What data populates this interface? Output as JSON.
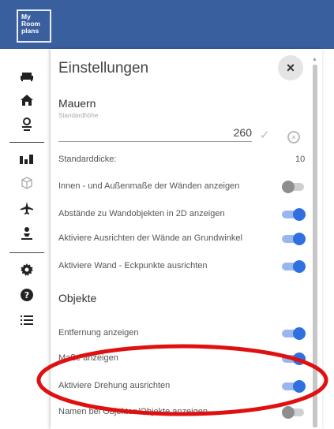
{
  "logo": {
    "lines": [
      "My",
      "Room",
      "plans"
    ]
  },
  "sidebar": {
    "items": [
      {
        "icon": "sofa-icon"
      },
      {
        "icon": "home-icon"
      },
      {
        "icon": "person-pin-icon"
      },
      {
        "icon": "walls-icon"
      },
      {
        "icon": "cube-icon"
      },
      {
        "icon": "plane-icon"
      },
      {
        "icon": "person-compass-icon"
      },
      {
        "icon": "gear-icon"
      },
      {
        "icon": "help-icon"
      },
      {
        "icon": "list-icon"
      }
    ]
  },
  "panel": {
    "title": "Einstellungen",
    "close_label": "×",
    "walls": {
      "title": "Mauern",
      "height_label": "Standardhöhe",
      "height_value": "260",
      "thickness_label": "Standarddicke:",
      "thickness_value": "10",
      "rows": [
        {
          "label": "Innen - und Außenmaße der Wänden anzeigen",
          "on": false
        },
        {
          "label": "Abstände zu Wandobjekten in 2D anzeigen",
          "on": true
        },
        {
          "label": "Aktiviere Ausrichten der Wände an Grundwinkel",
          "on": true
        },
        {
          "label": "Aktiviere Wand - Eckpunkte ausrichten",
          "on": true
        }
      ]
    },
    "objects": {
      "title": "Objekte",
      "rows": [
        {
          "label": "Entfernung anzeigen",
          "on": true
        },
        {
          "label": "Maße anzeigen",
          "on": true
        },
        {
          "label": "Aktiviere Drehung ausrichten",
          "on": true
        },
        {
          "label": "Namen bei Objekten/Objekte anzeigen",
          "on": false
        }
      ]
    }
  },
  "colors": {
    "topbar": "#3a5f9f",
    "toggle_on": "#2f6fe0",
    "annotation": "#e01010"
  }
}
